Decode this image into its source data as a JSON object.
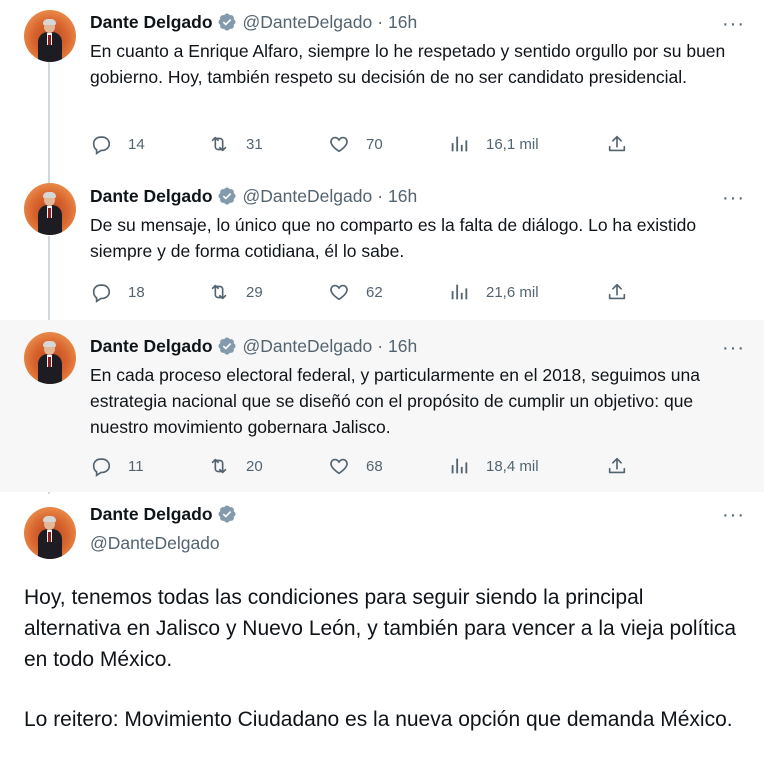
{
  "thread": [
    {
      "name": "Dante Delgado",
      "handle": "@DanteDelgado",
      "separator": "·",
      "time": "16h",
      "text": "En cuanto a Enrique Alfaro, siempre lo he respetado y sentido orgullo por su buen gobierno. Hoy, también respeto su decisión de no ser candidato presidencial.",
      "replies": "14",
      "retweets": "31",
      "likes": "70",
      "views": "16,1 mil"
    },
    {
      "name": "Dante Delgado",
      "handle": "@DanteDelgado",
      "separator": "·",
      "time": "16h",
      "text": "De su mensaje, lo único que no comparto es la falta de diálogo. Lo ha existido siempre y de forma cotidiana, él lo sabe.",
      "replies": "18",
      "retweets": "29",
      "likes": "62",
      "views": "21,6 mil"
    },
    {
      "name": "Dante Delgado",
      "handle": "@DanteDelgado",
      "separator": "·",
      "time": "16h",
      "text": "En cada proceso electoral federal, y particularmente en el 2018, seguimos una estrategia nacional que se diseñó con el propósito de cumplir un objetivo: que nuestro movimiento gobernara Jalisco.",
      "replies": "11",
      "retweets": "20",
      "likes": "68",
      "views": "18,4 mil"
    }
  ],
  "main": {
    "name": "Dante Delgado",
    "handle": "@DanteDelgado",
    "paragraph1": "Hoy, tenemos todas las condiciones para seguir siendo la principal alternativa en Jalisco y Nuevo León, y también para vencer a la vieja política en todo México.",
    "paragraph2": "Lo reitero: Movimiento Ciudadano es la nueva opción que demanda México."
  },
  "more_label": "···",
  "colors": {
    "text": "#0f1419",
    "secondary": "#536471",
    "verified": "#829aab",
    "highlight_bg": "#f7f7f7",
    "thread_line": "#cfd9de"
  },
  "icons": [
    "reply-icon",
    "retweet-icon",
    "like-icon",
    "views-icon",
    "share-icon",
    "verified-badge-icon",
    "more-icon"
  ]
}
